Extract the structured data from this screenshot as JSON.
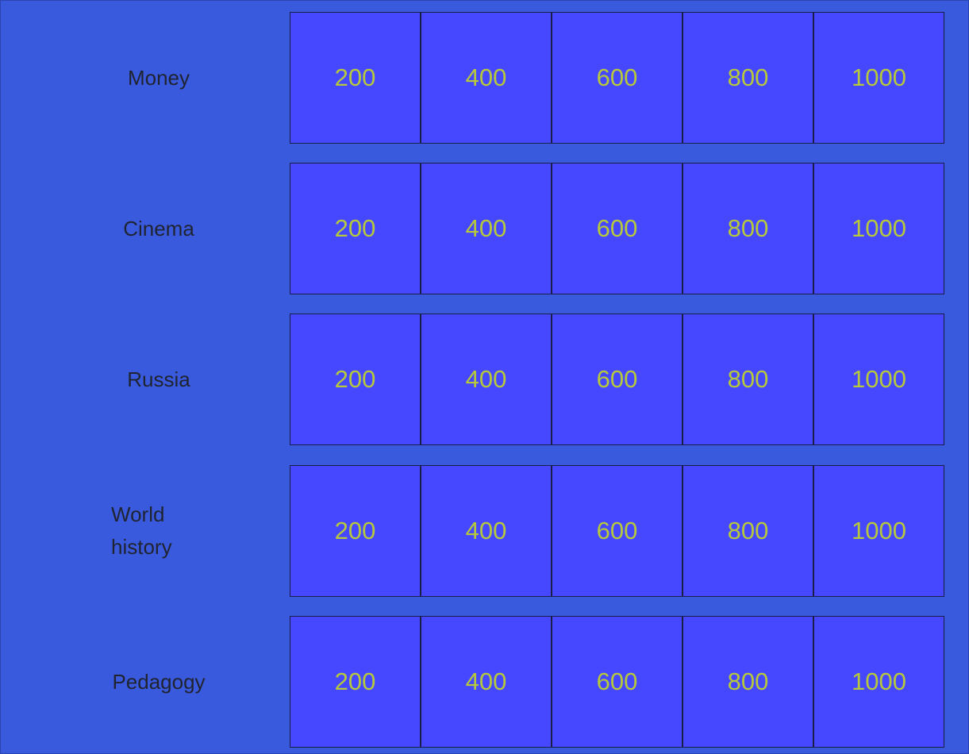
{
  "board": {
    "rows": [
      {
        "category": "Money",
        "values": [
          "200",
          "400",
          "600",
          "800",
          "1000"
        ]
      },
      {
        "category": "Cinema",
        "values": [
          "200",
          "400",
          "600",
          "800",
          "1000"
        ]
      },
      {
        "category": "Russia",
        "values": [
          "200",
          "400",
          "600",
          "800",
          "1000"
        ]
      },
      {
        "category": "World history",
        "values": [
          "200",
          "400",
          "600",
          "800",
          "1000"
        ]
      },
      {
        "category": "Pedagogy",
        "values": [
          "200",
          "400",
          "600",
          "800",
          "1000"
        ]
      }
    ]
  },
  "colors": {
    "background": "#3a5ade",
    "tile": "#4648ff",
    "tile_text": "#b7c93b",
    "category_text": "#1f2430"
  }
}
